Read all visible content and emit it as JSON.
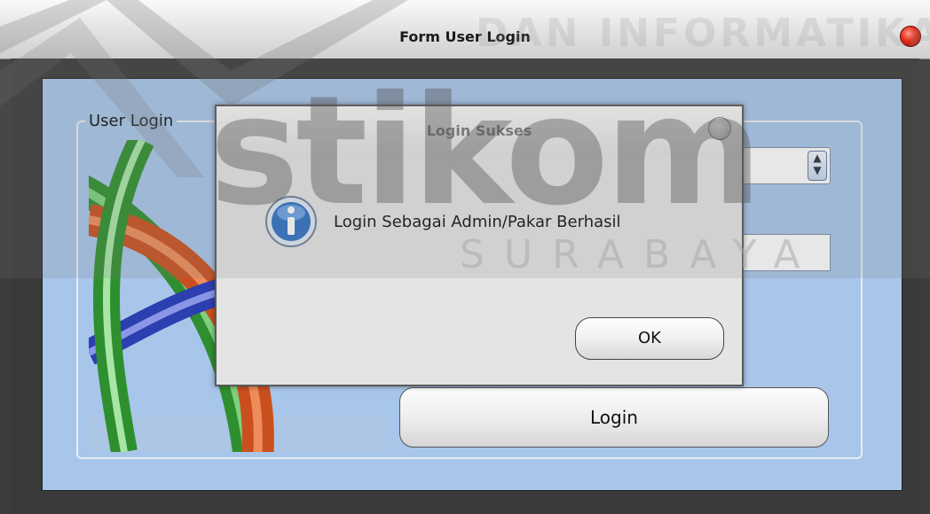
{
  "window": {
    "title": "Form User Login"
  },
  "form": {
    "group_label": "User Login",
    "login_button": "Login",
    "dropdown_value": "",
    "text_field_value": ""
  },
  "dialog": {
    "title": "Login Sukses",
    "message": "Login Sebagai Admin/Pakar Berhasil",
    "ok_label": "OK",
    "icon": "info-icon"
  },
  "watermark": {
    "top_text": "DAN INFORMATIKA",
    "logo_text": "stikom",
    "city_text": "SURABAYA"
  },
  "colors": {
    "panel": "#a8c6ea",
    "close_button": "#e52b16",
    "info_icon": "#2f6fc4"
  }
}
